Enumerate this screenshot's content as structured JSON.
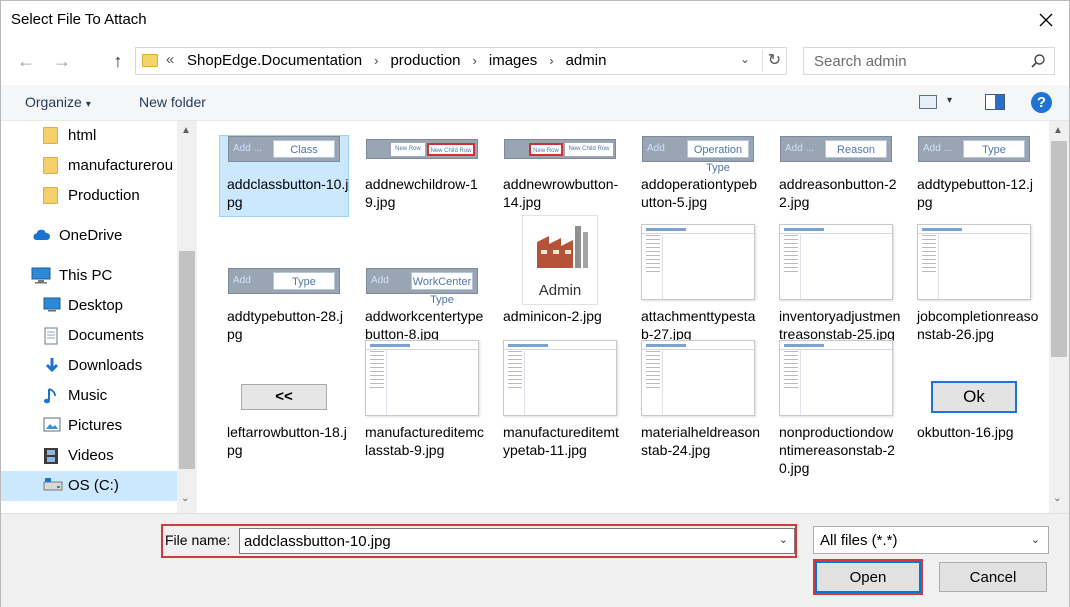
{
  "window": {
    "title": "Select File To Attach",
    "close_glyph": "✕"
  },
  "nav": {
    "back_glyph": "←",
    "forward_glyph": "→",
    "up_glyph": "↑",
    "breadcrumb": [
      "ShopEdge.Documentation",
      "production",
      "images",
      "admin"
    ],
    "breadcrumb_start": "«",
    "separator": "›",
    "dropdown_glyph": "⌄",
    "refresh_glyph": "↻",
    "search_placeholder": "Search admin"
  },
  "toolbar": {
    "organize_label": "Organize",
    "organize_arrow": "▾",
    "new_folder_label": "New folder",
    "view_arrow": "▾",
    "help_label": "?"
  },
  "sidebar": {
    "items": [
      {
        "label": "html",
        "icon": "folder-icon",
        "indent": 1
      },
      {
        "label": "manufacturerou",
        "icon": "folder-icon",
        "indent": 1
      },
      {
        "label": "Production",
        "icon": "folder-icon",
        "indent": 1
      },
      {
        "label": "OneDrive",
        "icon": "cloud-icon",
        "indent": 0
      },
      {
        "label": "This PC",
        "icon": "computer-icon",
        "indent": 0
      },
      {
        "label": "Desktop",
        "icon": "desktop-icon",
        "indent": 1
      },
      {
        "label": "Documents",
        "icon": "documents-icon",
        "indent": 1
      },
      {
        "label": "Downloads",
        "icon": "downloads-icon",
        "indent": 1
      },
      {
        "label": "Music",
        "icon": "music-icon",
        "indent": 1
      },
      {
        "label": "Pictures",
        "icon": "pictures-icon",
        "indent": 1
      },
      {
        "label": "Videos",
        "icon": "videos-icon",
        "indent": 1
      },
      {
        "label": "OS (C:)",
        "icon": "drive-icon",
        "indent": 1,
        "selected": true
      }
    ],
    "scroll_up": "▲",
    "scroll_down": "⌄"
  },
  "files": [
    {
      "name": "addclassbutton-10.jpg",
      "thumb": "button",
      "left": "Add ...",
      "right": "Class",
      "selected": true
    },
    {
      "name": "addnewchildrow-19.jpg",
      "thumb": "row",
      "tab1": "New Row",
      "tab2": "New Child Row",
      "red": 2
    },
    {
      "name": "addnewrowbutton-14.jpg",
      "thumb": "row",
      "tab1": "New Row",
      "tab2": "New Child Row",
      "red": 1
    },
    {
      "name": "addoperationtypebutton-5.jpg",
      "thumb": "button",
      "left": "Add",
      "right": "Operation Type"
    },
    {
      "name": "addreasonbutton-22.jpg",
      "thumb": "button",
      "left": "Add ...",
      "right": "Reason"
    },
    {
      "name": "addtypebutton-12.jpg",
      "thumb": "button",
      "left": "Add ...",
      "right": "Type"
    },
    {
      "name": "addtypebutton-28.jpg",
      "thumb": "button",
      "left": "Add",
      "right": "Type"
    },
    {
      "name": "addworkcentertypebutton-8.jpg",
      "thumb": "button",
      "left": "Add",
      "right": "WorkCenter Type"
    },
    {
      "name": "adminicon-2.jpg",
      "thumb": "admin",
      "caption": "Admin"
    },
    {
      "name": "attachmenttypestab-27.jpg",
      "thumb": "page"
    },
    {
      "name": "inventoryadjustmentreasonstab-25.jpg",
      "thumb": "page"
    },
    {
      "name": "jobcompletionreasonstab-26.jpg",
      "thumb": "page"
    },
    {
      "name": "leftarrowbutton-18.jpg",
      "thumb": "arrow",
      "caption": "<<"
    },
    {
      "name": "manufactureditemclasstab-9.jpg",
      "thumb": "page"
    },
    {
      "name": "manufactureditemtypetab-11.jpg",
      "thumb": "page"
    },
    {
      "name": "materialheldreasonstab-24.jpg",
      "thumb": "page"
    },
    {
      "name": "nonproductiondowntimereasonstab-20.jpg",
      "thumb": "page"
    },
    {
      "name": "okbutton-16.jpg",
      "thumb": "ok",
      "caption": "Ok"
    }
  ],
  "bottom": {
    "file_name_label": "File name:",
    "file_name_value": "addclassbutton-10.jpg",
    "filter_value": "All files (*.*)",
    "open_label": "Open",
    "cancel_label": "Cancel"
  },
  "colors": {
    "selection": "#cce8ff",
    "highlight_red": "#d0383e",
    "accent_blue": "#0078d7"
  }
}
